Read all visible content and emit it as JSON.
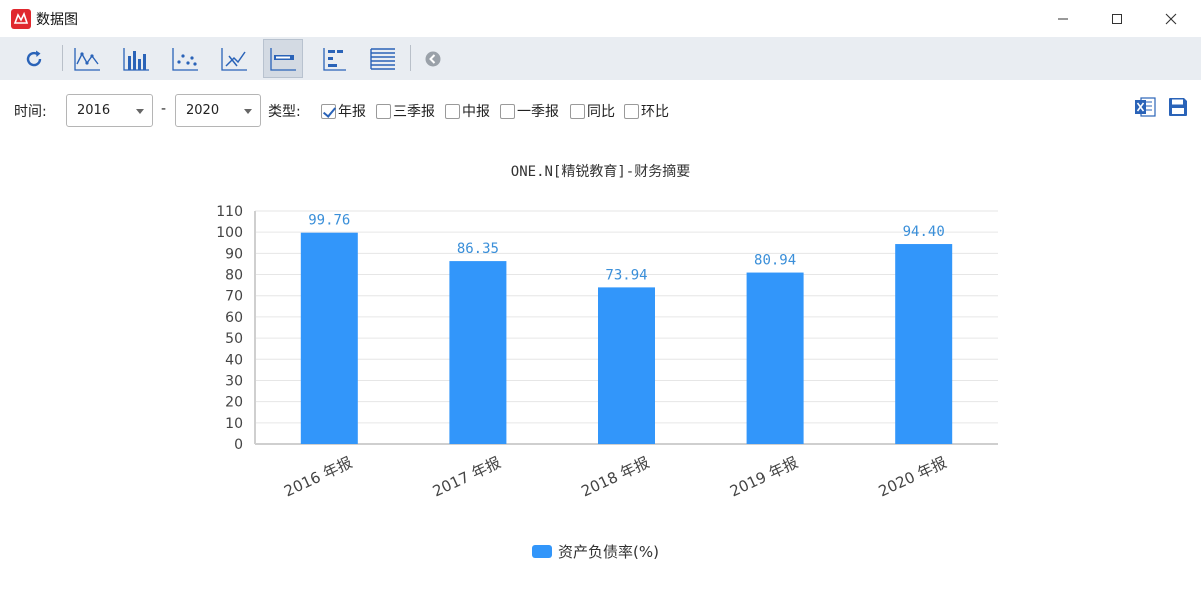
{
  "window": {
    "title": "数据图"
  },
  "toolbar": {
    "buttons": [
      {
        "icon": "refresh-icon"
      },
      {
        "icon": "line-chart-icon"
      },
      {
        "icon": "bar-chart-icon"
      },
      {
        "icon": "scatter-chart-icon"
      },
      {
        "icon": "trend-chart-icon"
      },
      {
        "icon": "horizontal-bar-icon"
      },
      {
        "icon": "tree-list-icon"
      },
      {
        "icon": "table-list-icon"
      },
      {
        "icon": "back-icon"
      }
    ]
  },
  "filters": {
    "time_label": "时间:",
    "from_year": "2016",
    "dash": "-",
    "to_year": "2020",
    "type_label": "类型:",
    "types": [
      {
        "label": "年报",
        "checked": true
      },
      {
        "label": "三季报",
        "checked": false
      },
      {
        "label": "中报",
        "checked": false
      },
      {
        "label": "一季报",
        "checked": false
      },
      {
        "label": "同比",
        "checked": false
      },
      {
        "label": "环比",
        "checked": false
      }
    ]
  },
  "actions": {
    "excel_icon": "excel-export-icon",
    "save_icon": "save-icon"
  },
  "colors": {
    "bar": "#3296fa",
    "data_label": "#3a8fd9",
    "grid": "#e6e6e6",
    "axis": "#cfcfcf"
  },
  "chart_data": {
    "type": "bar",
    "title": "ONE.N[精锐教育]-财务摘要",
    "categories": [
      "2016 年报",
      "2017 年报",
      "2018 年报",
      "2019 年报",
      "2020 年报"
    ],
    "series": [
      {
        "name": "资产负债率(%)",
        "values": [
          99.76,
          86.35,
          73.94,
          80.94,
          94.4
        ],
        "labels": [
          "99.76",
          "86.35",
          "73.94",
          "80.94",
          "94.40"
        ]
      }
    ],
    "ylim": [
      0,
      110
    ],
    "yticks": [
      "0",
      "10",
      "20",
      "30",
      "40",
      "50",
      "60",
      "70",
      "80",
      "90",
      "100",
      "110"
    ],
    "grid": true,
    "legend_position": "bottom-center"
  }
}
